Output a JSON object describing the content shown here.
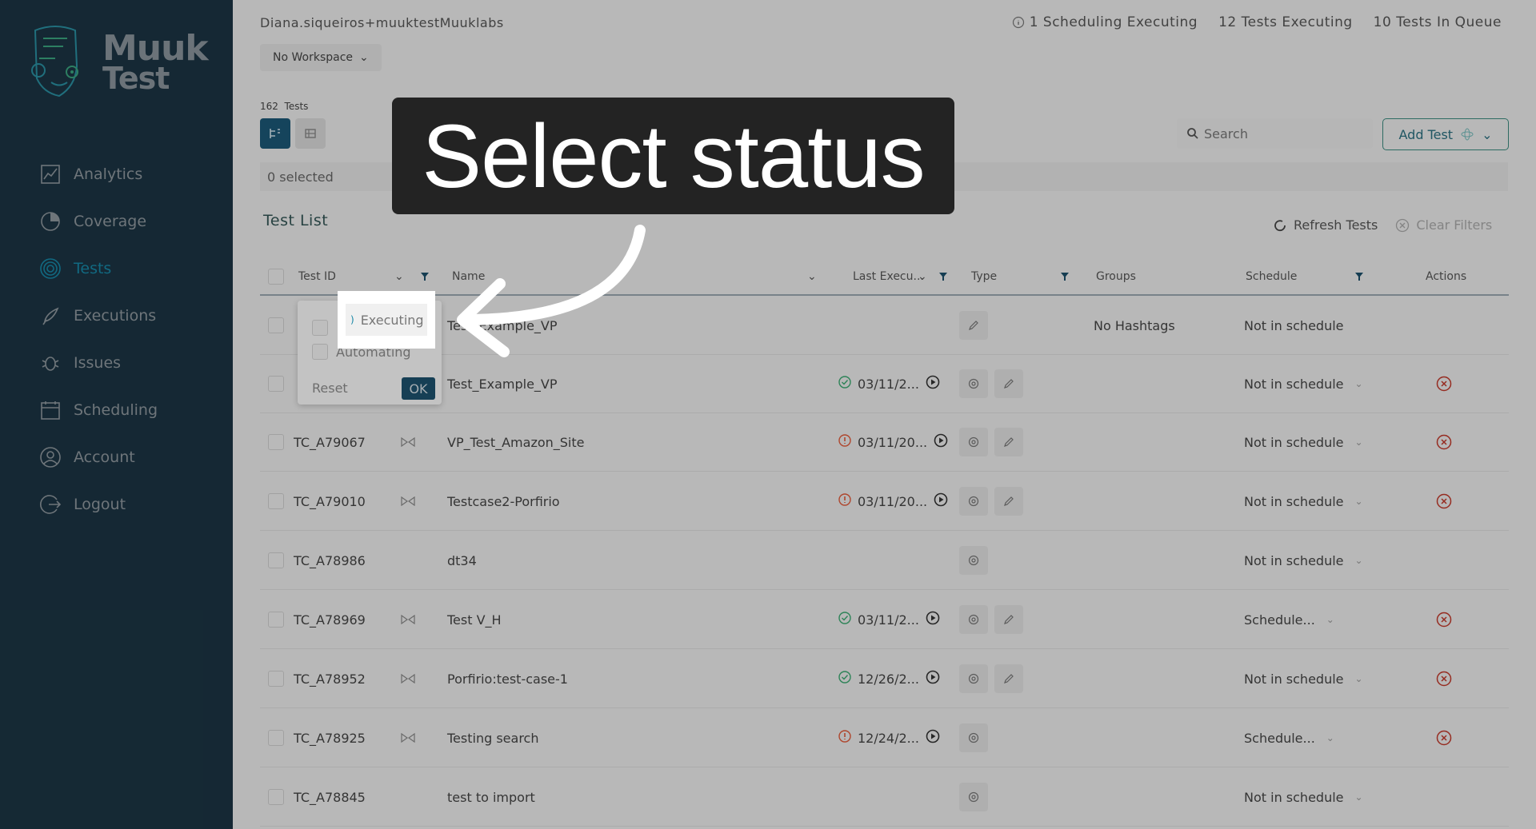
{
  "brand": {
    "line1": "Muuk",
    "line2": "Test"
  },
  "sidebar": {
    "items": [
      {
        "label": "Analytics",
        "icon": "analytics-icon"
      },
      {
        "label": "Coverage",
        "icon": "coverage-icon"
      },
      {
        "label": "Tests",
        "icon": "tests-icon",
        "active": true
      },
      {
        "label": "Executions",
        "icon": "rocket-icon"
      },
      {
        "label": "Issues",
        "icon": "bug-icon"
      },
      {
        "label": "Scheduling",
        "icon": "calendar-icon"
      },
      {
        "label": "Account",
        "icon": "user-icon"
      },
      {
        "label": "Logout",
        "icon": "logout-icon"
      }
    ]
  },
  "header": {
    "user": "Diana.siqueiros+muuktestMuuklabs",
    "scheduling": "1 Scheduling Executing",
    "tests_executing": "12 Tests Executing",
    "in_queue": "10 Tests In Queue",
    "workspace": "No Workspace"
  },
  "toolbar": {
    "count": "162",
    "count_label": "Tests",
    "selected": "0 selected",
    "search_placeholder": "Search",
    "add_test": "Add Test"
  },
  "list": {
    "title": "Test List",
    "refresh": "Refresh Tests",
    "clear": "Clear Filters"
  },
  "columns": {
    "test_id": "Test ID",
    "name": "Name",
    "last_exec": "Last Execu...",
    "type": "Type",
    "groups": "Groups",
    "schedule": "Schedule",
    "actions": "Actions"
  },
  "filter": {
    "option1": "Executing",
    "option2": "Automating",
    "reset": "Reset",
    "ok": "OK"
  },
  "rows": [
    {
      "id": "",
      "name": "Test_Example_VP",
      "date": "",
      "status": "",
      "groups": "No Hashtags",
      "schedule": "Not in schedule",
      "has_action": false,
      "has_video": false,
      "type_edit": false,
      "type_gear": false,
      "type_pencil_only": true
    },
    {
      "id": "",
      "name": "Test_Example_VP",
      "date": "03/11/2...",
      "status": "pass",
      "groups": "",
      "schedule": "Not in schedule",
      "has_action": true,
      "has_video": false,
      "type_edit": true,
      "type_gear": true
    },
    {
      "id": "TC_A79067",
      "name": "VP_Test_Amazon_Site",
      "date": "03/11/20...",
      "status": "fail",
      "groups": "",
      "schedule": "Not in schedule",
      "has_action": true,
      "has_video": true,
      "type_edit": true,
      "type_gear": true
    },
    {
      "id": "TC_A79010",
      "name": "Testcase2-Porfirio",
      "date": "03/11/20...",
      "status": "fail",
      "groups": "",
      "schedule": "Not in schedule",
      "has_action": true,
      "has_video": true,
      "type_edit": true,
      "type_gear": true
    },
    {
      "id": "TC_A78986",
      "name": "dt34",
      "date": "",
      "status": "",
      "groups": "",
      "schedule": "Not in schedule",
      "has_action": false,
      "has_video": false,
      "type_edit": false,
      "type_gear": true
    },
    {
      "id": "TC_A78969",
      "name": "Test V_H",
      "date": "03/11/2...",
      "status": "pass",
      "groups": "",
      "schedule": "Schedule...",
      "has_action": true,
      "has_video": true,
      "type_edit": true,
      "type_gear": true
    },
    {
      "id": "TC_A78952",
      "name": "Porfirio:test-case-1",
      "date": "12/26/2...",
      "status": "pass",
      "groups": "",
      "schedule": "Not in schedule",
      "has_action": true,
      "has_video": true,
      "type_edit": true,
      "type_gear": true
    },
    {
      "id": "TC_A78925",
      "name": "Testing search",
      "date": "12/24/2...",
      "status": "fail",
      "groups": "",
      "schedule": "Schedule...",
      "has_action": true,
      "has_video": true,
      "type_edit": false,
      "type_gear": true
    },
    {
      "id": "TC_A78845",
      "name": "test to import",
      "date": "",
      "status": "",
      "groups": "",
      "schedule": "Not in schedule",
      "has_action": false,
      "has_video": false,
      "type_edit": false,
      "type_gear": true
    }
  ],
  "callout": {
    "text": "Select status"
  },
  "colors": {
    "sidebar": "#1b3443",
    "accent": "#1787a6",
    "pass": "#3aa870",
    "fail": "#e05a3a",
    "action": "#c0392b"
  }
}
